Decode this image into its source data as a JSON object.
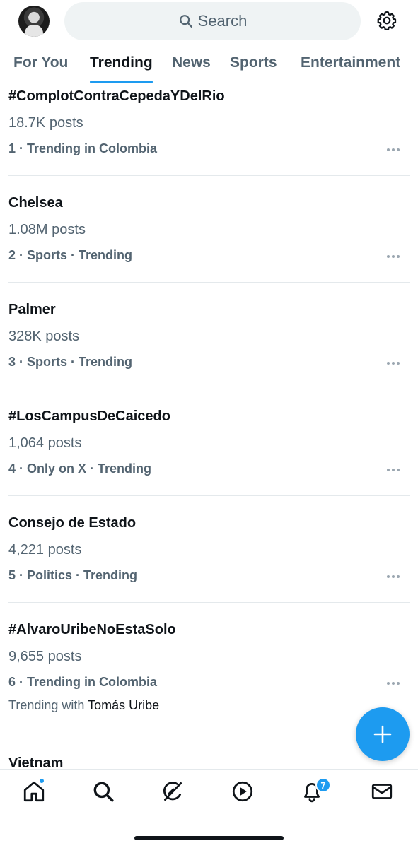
{
  "header": {
    "search_placeholder": "Search",
    "icons": {
      "avatar": "avatar",
      "search": "search-icon",
      "settings": "gear-icon"
    }
  },
  "tabs": [
    {
      "label": "For You",
      "active": false
    },
    {
      "label": "Trending",
      "active": true
    },
    {
      "label": "News",
      "active": false
    },
    {
      "label": "Sports",
      "active": false
    },
    {
      "label": "Entertainment",
      "active": false
    }
  ],
  "trends": [
    {
      "title": "#ComplotContraCepedaYDelRio",
      "count": "18.7K posts",
      "meta": "1 · Trending in Colombia"
    },
    {
      "title": "Chelsea",
      "count": "1.08M posts",
      "meta": "2 · Sports · Trending"
    },
    {
      "title": "Palmer",
      "count": "328K posts",
      "meta": "3 · Sports · Trending"
    },
    {
      "title": "#LosCampusDeCaicedo",
      "count": "1,064 posts",
      "meta": "4 · Only on X · Trending"
    },
    {
      "title": "Consejo de Estado",
      "count": "4,221 posts",
      "meta": "5 · Politics · Trending"
    },
    {
      "title": "#AlvaroUribeNoEstaSolo",
      "count": "9,655 posts",
      "meta": "6 · Trending in Colombia",
      "with_prefix": "Trending with",
      "with_name": "Tomás Uribe"
    },
    {
      "title": "Vietnam"
    }
  ],
  "bottom_nav": {
    "items": [
      "home-icon",
      "search-icon",
      "grok-icon",
      "play-icon",
      "bell-icon",
      "mail-icon"
    ],
    "notifications_count": "7"
  },
  "colors": {
    "accent": "#1d9bf0",
    "muted": "#536471",
    "text": "#0f1419"
  }
}
